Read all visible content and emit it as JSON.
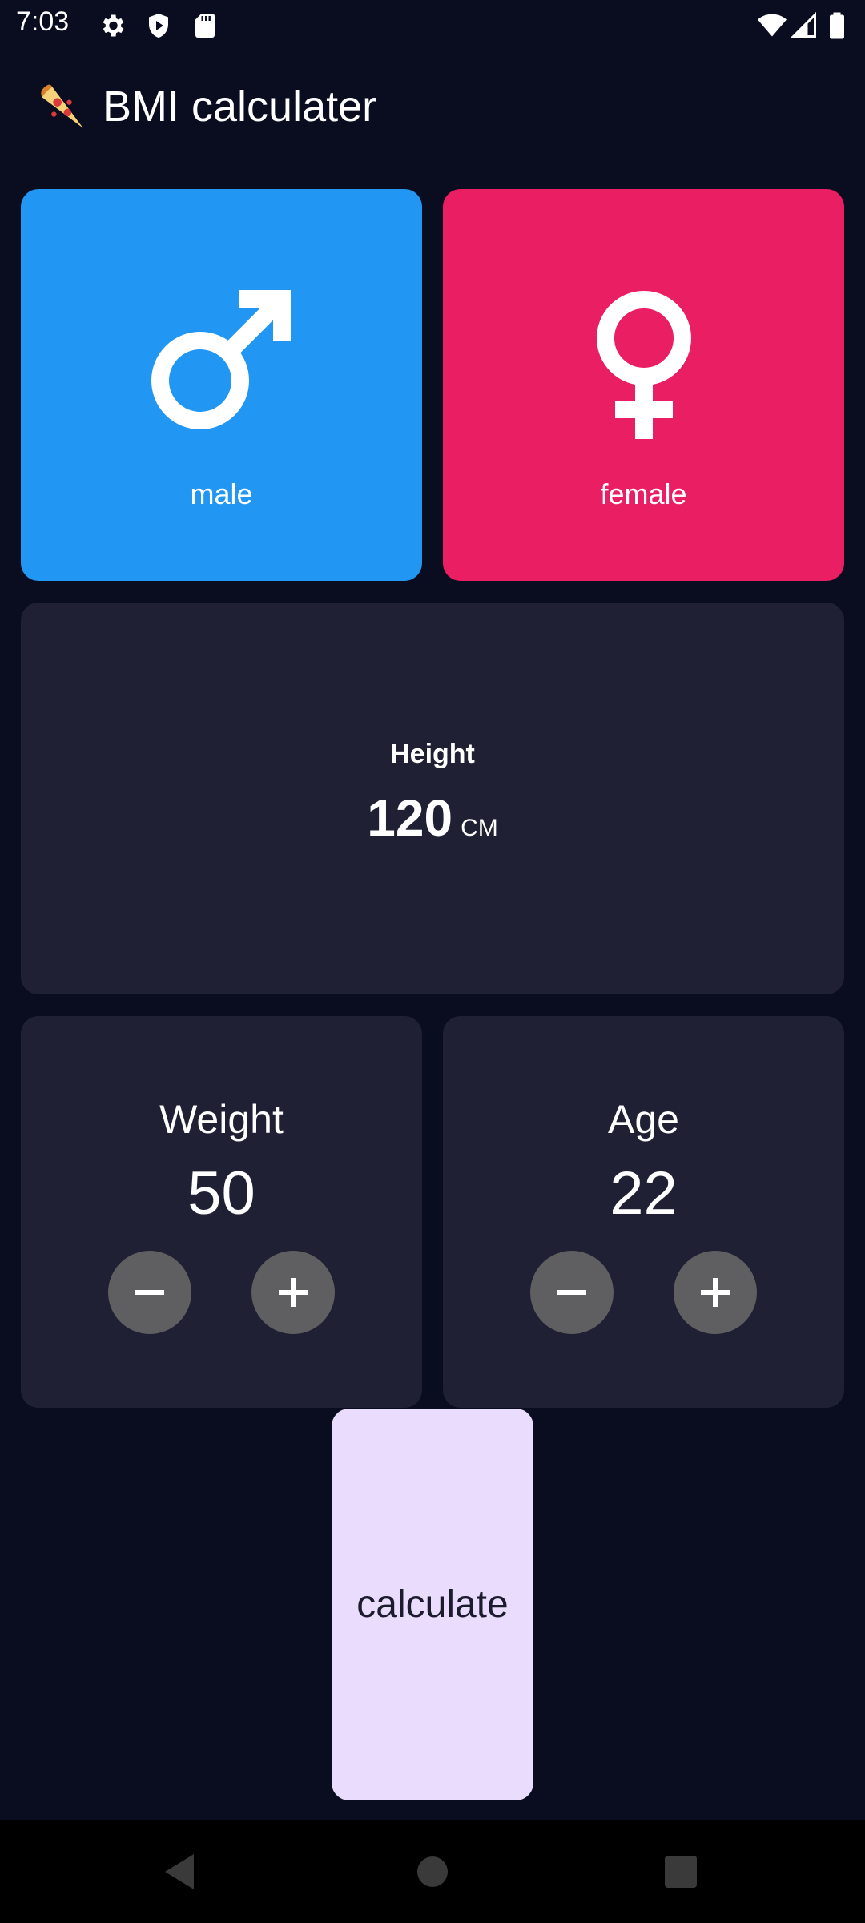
{
  "status_bar": {
    "time": "7:03",
    "left_icons": [
      "gear-icon",
      "shield-play-icon",
      "sd-card-icon"
    ],
    "right_icons": [
      "wifi-icon",
      "signal-icon",
      "battery-icon"
    ]
  },
  "app_bar": {
    "logo_icon": "pizza-icon",
    "title": "BMI calculater"
  },
  "gender": {
    "male": {
      "label": "male",
      "icon": "male-symbol-icon",
      "color": "#2196f3"
    },
    "female": {
      "label": "female",
      "icon": "female-symbol-icon",
      "color": "#e91e63"
    }
  },
  "height": {
    "label": "Height",
    "value": "120",
    "unit": "CM"
  },
  "weight": {
    "label": "Weight",
    "value": "50"
  },
  "age": {
    "label": "Age",
    "value": "22"
  },
  "calculate": {
    "label": "calculate",
    "color": "#eadcfd"
  },
  "nav_bar": {
    "buttons": [
      "back-icon",
      "home-icon",
      "recents-icon"
    ]
  },
  "colors": {
    "background": "#0a0c1f",
    "card": "#1f2033",
    "round_button": "#5f5f62"
  }
}
